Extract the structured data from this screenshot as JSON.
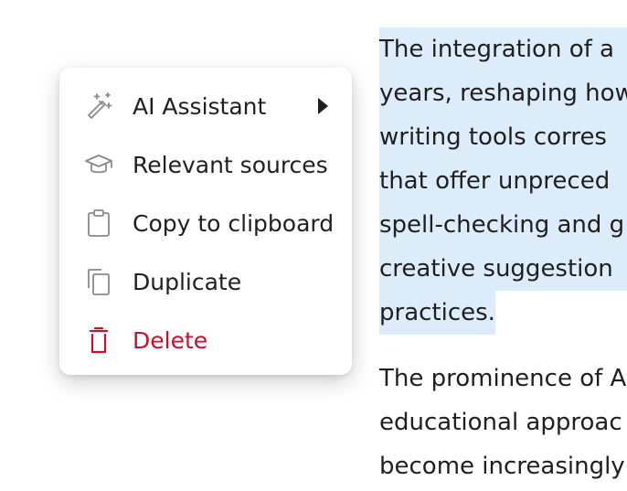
{
  "document": {
    "paragraph1": [
      "The integration of a",
      "years, reshaping how",
      "writing tools corres",
      "that offer unpreced",
      "spell-checking and g",
      "creative suggestion",
      "practices."
    ],
    "paragraph2": [
      "The prominence of A",
      "educational approac",
      "become increasingly"
    ],
    "highlight_color": "#dcecfb"
  },
  "context_menu": {
    "items": [
      {
        "label": "AI Assistant",
        "icon": "magic-wand-icon",
        "has_submenu": true
      },
      {
        "label": "Relevant sources",
        "icon": "graduation-cap-icon",
        "has_submenu": false
      },
      {
        "label": "Copy to clipboard",
        "icon": "clipboard-icon",
        "has_submenu": false
      },
      {
        "label": "Duplicate",
        "icon": "duplicate-icon",
        "has_submenu": false
      },
      {
        "label": "Delete",
        "icon": "trash-icon",
        "has_submenu": false,
        "danger": true
      }
    ],
    "danger_color": "#c8102e",
    "icon_color": "#8a8a8a"
  }
}
